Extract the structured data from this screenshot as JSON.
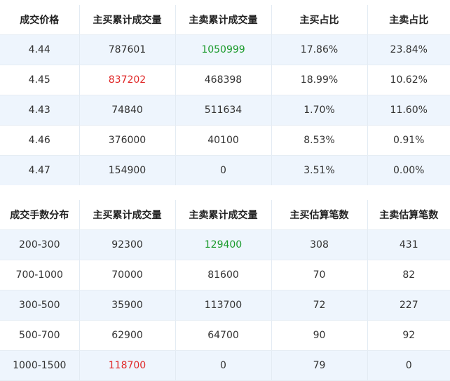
{
  "colors": {
    "up": "#e02828",
    "down": "#1a9a2c",
    "row_alt": "#eef5fd"
  },
  "price_table": {
    "headers": [
      "成交价格",
      "主买累计成交量",
      "主卖累计成交量",
      "主买占比",
      "主卖占比"
    ],
    "rows": [
      [
        "4.44",
        "787601",
        "1050999",
        "17.86%",
        "23.84%"
      ],
      [
        "4.45",
        "837202",
        "468398",
        "18.99%",
        "10.62%"
      ],
      [
        "4.43",
        "74840",
        "511634",
        "1.70%",
        "11.60%"
      ],
      [
        "4.46",
        "376000",
        "40100",
        "8.53%",
        "0.91%"
      ],
      [
        "4.47",
        "154900",
        "0",
        "3.51%",
        "0.00%"
      ]
    ]
  },
  "lot_table": {
    "headers": [
      "成交手数分布",
      "主买累计成交量",
      "主卖累计成交量",
      "主买估算笔数",
      "主卖估算笔数"
    ],
    "rows": [
      [
        "200-300",
        "92300",
        "129400",
        "308",
        "431"
      ],
      [
        "700-1000",
        "70000",
        "81600",
        "70",
        "82"
      ],
      [
        "300-500",
        "35900",
        "113700",
        "72",
        "227"
      ],
      [
        "500-700",
        "62900",
        "64700",
        "90",
        "92"
      ],
      [
        "1000-1500",
        "118700",
        "0",
        "79",
        "0"
      ]
    ]
  }
}
